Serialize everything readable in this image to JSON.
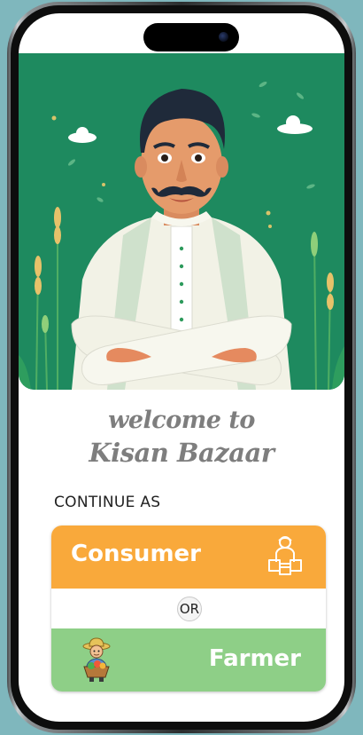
{
  "welcome": {
    "line1": "welcome to",
    "line2": "Kisan Bazaar"
  },
  "continue_label": "CONTINUE AS",
  "options": {
    "consumer": {
      "label": "Consumer",
      "icon": "consumer-with-boxes-icon",
      "color": "#f9a93b"
    },
    "separator": "OR",
    "farmer": {
      "label": "Farmer",
      "icon": "farmer-with-vegetable-basket-icon",
      "color": "#8ecf87"
    }
  },
  "hero": {
    "illustration": "smiling-farmer-illustration",
    "background": "#1e8a5f"
  }
}
